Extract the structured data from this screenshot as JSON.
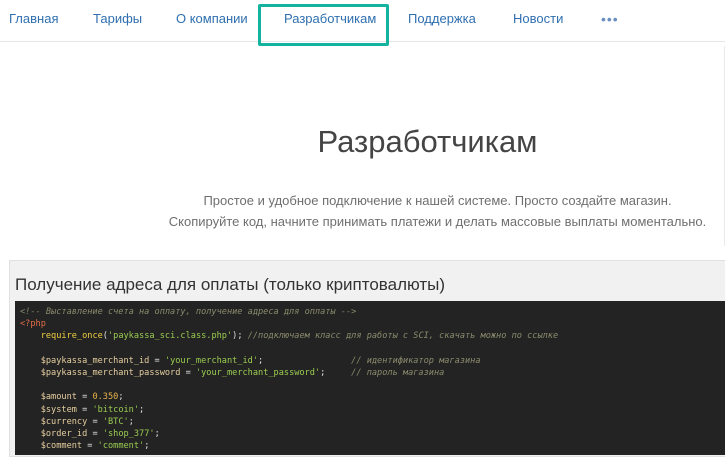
{
  "nav": {
    "items": [
      "Главная",
      "Тарифы",
      "О компании",
      "Разработчикам",
      "Поддержка",
      "Новости"
    ],
    "more": "•••"
  },
  "page": {
    "title": "Разработчикам",
    "subtitle_1": "Простое и удобное подключение к нашей системе. Просто создайте магазин.",
    "subtitle_2": "Скопируйте код, начните принимать платежи и делать массовые выплаты моментально."
  },
  "section": {
    "title": "Получение адреса для оплаты (только криптовалюты)"
  },
  "code": {
    "comment_header": "<!-- Выставление счета на оплату, получение адреса для оплаты -->",
    "php_open": "<?php",
    "require_fn": "require_once",
    "require_arg": "'paykassa_sci.class.php'",
    "require_comment": "//подключаем класс для работы с SCI, скачать можно по ссылке",
    "merchant_id_var": "$paykassa_merchant_id",
    "merchant_id_val": "'your_merchant_id'",
    "merchant_id_comment": "// идентификатор магазина",
    "merchant_pw_var": "$paykassa_merchant_password",
    "merchant_pw_val": "'your_merchant_password'",
    "merchant_pw_comment": "// пароль магазина",
    "amount_var": "$amount",
    "amount_val": "0.350",
    "system_var": "$system",
    "system_val": "'bitcoin'",
    "currency_var": "$currency",
    "currency_val": "'BTC'",
    "order_var": "$order_id",
    "order_val": "'shop_377'",
    "comment_var": "$comment",
    "comment_val": "'comment'"
  },
  "colors": {
    "link": "#2f6fb0",
    "highlight": "#13b3a0",
    "code_bg": "#232323"
  }
}
